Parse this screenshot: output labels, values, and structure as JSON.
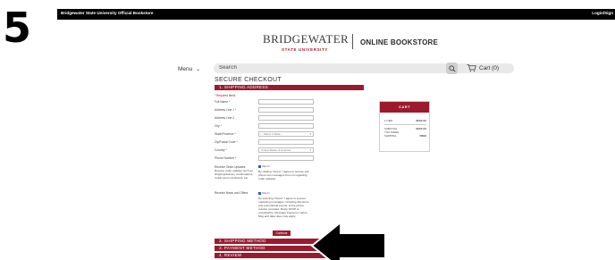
{
  "step_number": "5",
  "topbar": {
    "store_name": "Bridgewater State University Official Bookstore",
    "login": "Login/Sign"
  },
  "logo": {
    "main": "BRIDGEWATER",
    "sub": "STATE UNIVERSITY"
  },
  "store_title": "ONLINE BOOKSTORE",
  "nav": {
    "menu_label": "Menu",
    "search_placeholder": "Search",
    "cart_label": "Cart (0)"
  },
  "checkout": {
    "title": "SECURE CHECKOUT",
    "steps": [
      "1. SHIPPING ADDRESS",
      "2. SHIPPING METHOD",
      "3. PAYMENT METHOD",
      "4. REVIEW"
    ],
    "required_note": "* Required fields",
    "fields": [
      {
        "label": "Full Name *",
        "value": ""
      },
      {
        "label": "Address Line 1 *",
        "value": ""
      },
      {
        "label": "Address Line 2",
        "value": ""
      },
      {
        "label": "City *",
        "value": ""
      },
      {
        "label": "State/Province *",
        "value": "-- Select a State --"
      },
      {
        "label": "Zip/Postal Code *",
        "value": ""
      },
      {
        "label": "Country *",
        "value": "United States of America"
      },
      {
        "label": "Phone Number *",
        "value": ""
      }
    ],
    "order_updates": {
      "label": "Receive Order Updates",
      "sublabel": "Receive order updates such as shipping/delivery confirmations, rental return reminders, etc.",
      "optin": "Opt-in",
      "text": "By clicking \"Opt-in\" I agree to receive cell phone text messages from us regarding order updates."
    },
    "news_offers": {
      "label": "Receive News and Offers",
      "optin": "Opt-in",
      "text": "By selecting \"Opt-in\" I agree to receive marketing messages, including discounts and promotional events, at the phone number provided. Reply STOP to unsubscribe. Message frequency varies. Msg and data rates may apply."
    },
    "continue_label": "Continue"
  },
  "cart": {
    "header": "CART",
    "rows": [
      {
        "label": "1 ITEM",
        "value": "$XXX.XX"
      },
      {
        "label": "SUBTOTAL",
        "value": "$XXX.XX"
      },
      {
        "label": "YOU SAVED",
        "value": ""
      },
      {
        "label": "SHIPPING",
        "value": "FREE"
      }
    ]
  },
  "colors": {
    "brand": "#9b1b2d",
    "topbar": "#000000",
    "arrow": "#000000"
  },
  "icons": [
    "search-icon",
    "cart-icon",
    "chevron-down-icon",
    "arrow-icon"
  ]
}
